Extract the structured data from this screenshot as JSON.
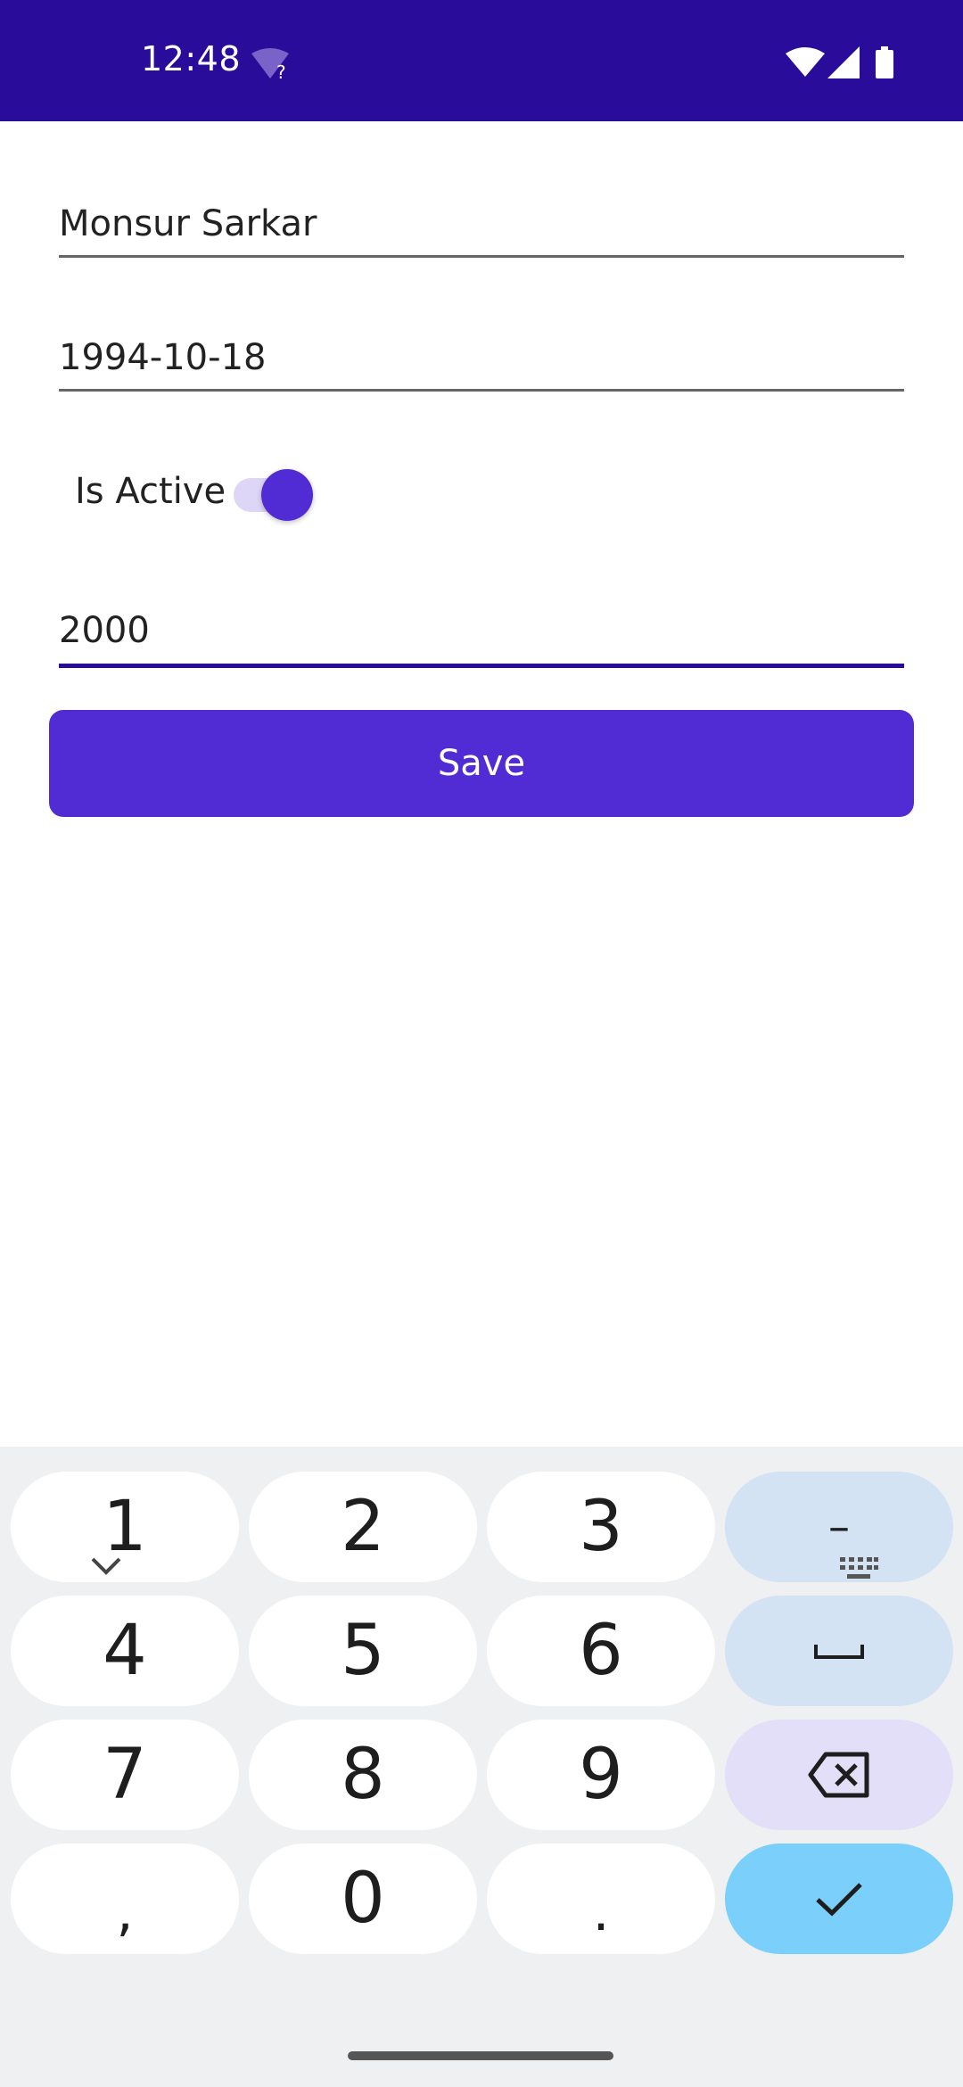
{
  "status_bar": {
    "time": "12:48",
    "wifi_question_mark": "?",
    "background": "#2a0c9a"
  },
  "form": {
    "name_value": "Monsur Sarkar",
    "date_value": "1994-10-18",
    "switch_label": "Is Active",
    "switch_on": true,
    "amount_value": "2000",
    "save_label": "Save",
    "accent_color": "#512bd4"
  },
  "keyboard": {
    "keys": [
      {
        "label": "1",
        "kind": "digit"
      },
      {
        "label": "2",
        "kind": "digit"
      },
      {
        "label": "3",
        "kind": "digit"
      },
      {
        "label": "–",
        "kind": "minus"
      },
      {
        "label": "4",
        "kind": "digit"
      },
      {
        "label": "5",
        "kind": "digit"
      },
      {
        "label": "6",
        "kind": "digit"
      },
      {
        "label": "",
        "kind": "space",
        "icon": "space-bar-icon"
      },
      {
        "label": "7",
        "kind": "digit"
      },
      {
        "label": "8",
        "kind": "digit"
      },
      {
        "label": "9",
        "kind": "digit"
      },
      {
        "label": "",
        "kind": "backspace",
        "icon": "backspace-icon"
      },
      {
        "label": ",",
        "kind": "comma"
      },
      {
        "label": "0",
        "kind": "digit"
      },
      {
        "label": ".",
        "kind": "period"
      },
      {
        "label": "",
        "kind": "enter",
        "icon": "checkmark-icon"
      }
    ],
    "hide_icon": "chevron-down-icon",
    "switch_keyboard_icon": "keyboard-icon"
  }
}
